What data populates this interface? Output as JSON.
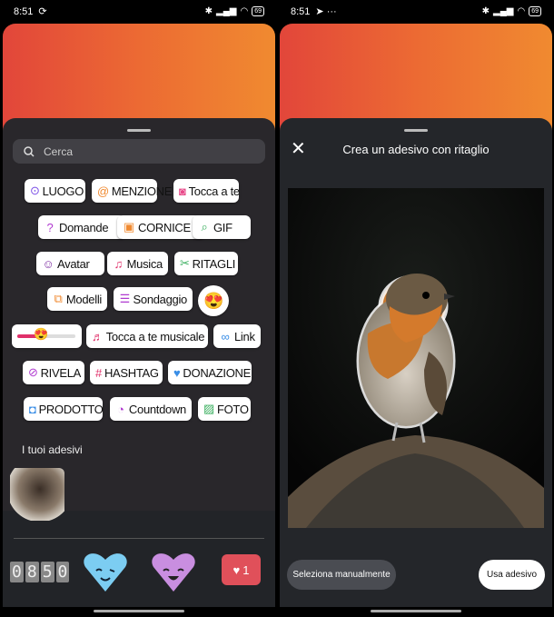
{
  "left": {
    "status": {
      "time": "8:51",
      "battery": "69"
    },
    "search": {
      "placeholder": "Cerca"
    },
    "stickers": [
      {
        "label": "LUOGO",
        "icon": "location-pin-icon",
        "color": "#7b4ee6"
      },
      {
        "label": "MENZIONE",
        "icon": "at-icon",
        "color": "#f08a30"
      },
      {
        "label": "Tocca a te",
        "icon": "camera-icon",
        "color": "#e84a8a"
      },
      {
        "label": "Domande",
        "icon": "question-bubble-icon",
        "color": "#b03ad0"
      },
      {
        "label": "CORNICE",
        "icon": "frame-icon",
        "color": "#f08a30"
      },
      {
        "label": "GIF",
        "icon": "search-icon",
        "color": "#3cb060"
      },
      {
        "label": "Avatar",
        "icon": "avatar-icon",
        "color": "#7b2aa0"
      },
      {
        "label": "Musica",
        "icon": "music-note-icon",
        "color": "#e0306a"
      },
      {
        "label": "RITAGLI",
        "icon": "scissors-icon",
        "color": "#3cb060"
      },
      {
        "label": "Modelli",
        "icon": "templates-icon",
        "color": "#f08a30"
      },
      {
        "label": "Sondaggio",
        "icon": "poll-icon",
        "color": "#b03ad0"
      },
      {
        "label": "Tocca a te musicale",
        "icon": "music-plus-icon",
        "color": "#e0306a"
      },
      {
        "label": "Link",
        "icon": "link-icon",
        "color": "#3a8ee6"
      },
      {
        "label": "RIVELA",
        "icon": "eye-off-icon",
        "color": "#b03ad0"
      },
      {
        "label": "HASHTAG",
        "icon": "hashtag-icon",
        "color": "#e0306a"
      },
      {
        "label": "DONAZIONE",
        "icon": "heart-coin-icon",
        "color": "#3a8ee6"
      },
      {
        "label": "PRODOTTO",
        "icon": "shopping-bag-icon",
        "color": "#3a8ee6"
      },
      {
        "label": "Countdown",
        "icon": "timer-icon",
        "color": "#b03ad0"
      },
      {
        "label": "FOTO",
        "icon": "photo-icon",
        "color": "#3cb060"
      }
    ],
    "my_stickers_label": "I tuoi adesivi",
    "clock": [
      "0",
      "8",
      "5",
      "0"
    ],
    "like_count": "1"
  },
  "right": {
    "status": {
      "time": "8:51",
      "battery": "69"
    },
    "title": "Crea un adesivo con ritaglio",
    "select_manual": "Seleziona manualmente",
    "use_sticker": "Usa adesivo"
  }
}
